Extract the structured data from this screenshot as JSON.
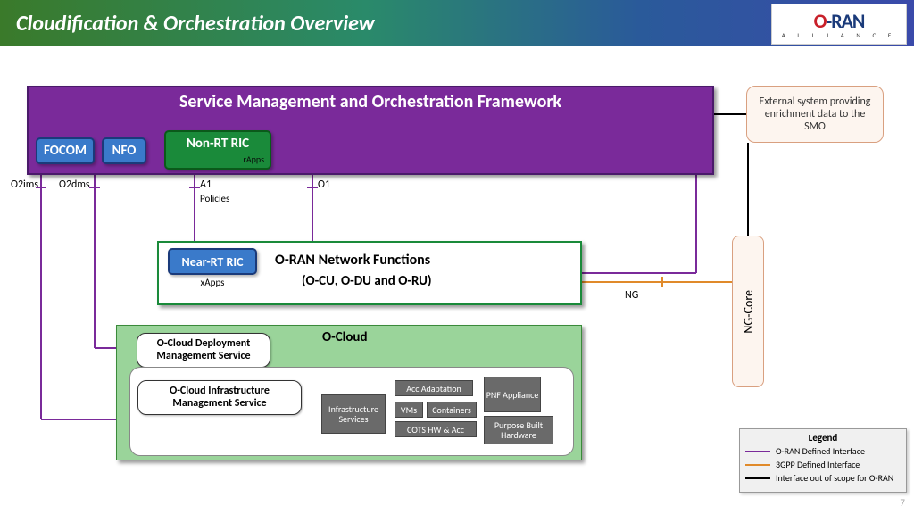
{
  "header": {
    "title": "Cloudification & Orchestration Overview"
  },
  "logo": {
    "brand_o": "O",
    "brand_ran": "-RAN",
    "sub": "A L L I A N C E"
  },
  "smo": {
    "title": "Service Management and Orchestration Framework",
    "focom": "FOCOM",
    "nfo": "NFO",
    "nonrt": "Non-RT RIC",
    "nonrt_sub": "rApps"
  },
  "ext": {
    "text": "External system providing enrichment data to the SMO"
  },
  "ifaces": {
    "o2ims": "O2ims",
    "o2dms": "O2dms",
    "a1": "A1",
    "a1_sub": "Policies",
    "o1": "O1",
    "ng": "NG"
  },
  "nf": {
    "nearrt": "Near-RT RIC",
    "xapps": "xApps",
    "title": "O-RAN Network Functions",
    "sub": "(O-CU, O-DU and O-RU)"
  },
  "ocloud": {
    "title": "O-Cloud",
    "dms": "O-Cloud Deployment Management Service",
    "ims": "O-Cloud Infrastructure Management Service",
    "infra": "Infrastructure Services",
    "acc": "Acc Adaptation",
    "vms": "VMs",
    "containers": "Containers",
    "cots": "COTS HW & Acc",
    "pnf": "PNF Appliance",
    "purpose": "Purpose Built Hardware"
  },
  "ngcore": {
    "label": "NG-Core"
  },
  "legend": {
    "title": "Legend",
    "oran": "O-RAN Defined Interface",
    "gpp": "3GPP Defined Interface",
    "out": "Interface out of scope for O-RAN"
  },
  "page": "7"
}
